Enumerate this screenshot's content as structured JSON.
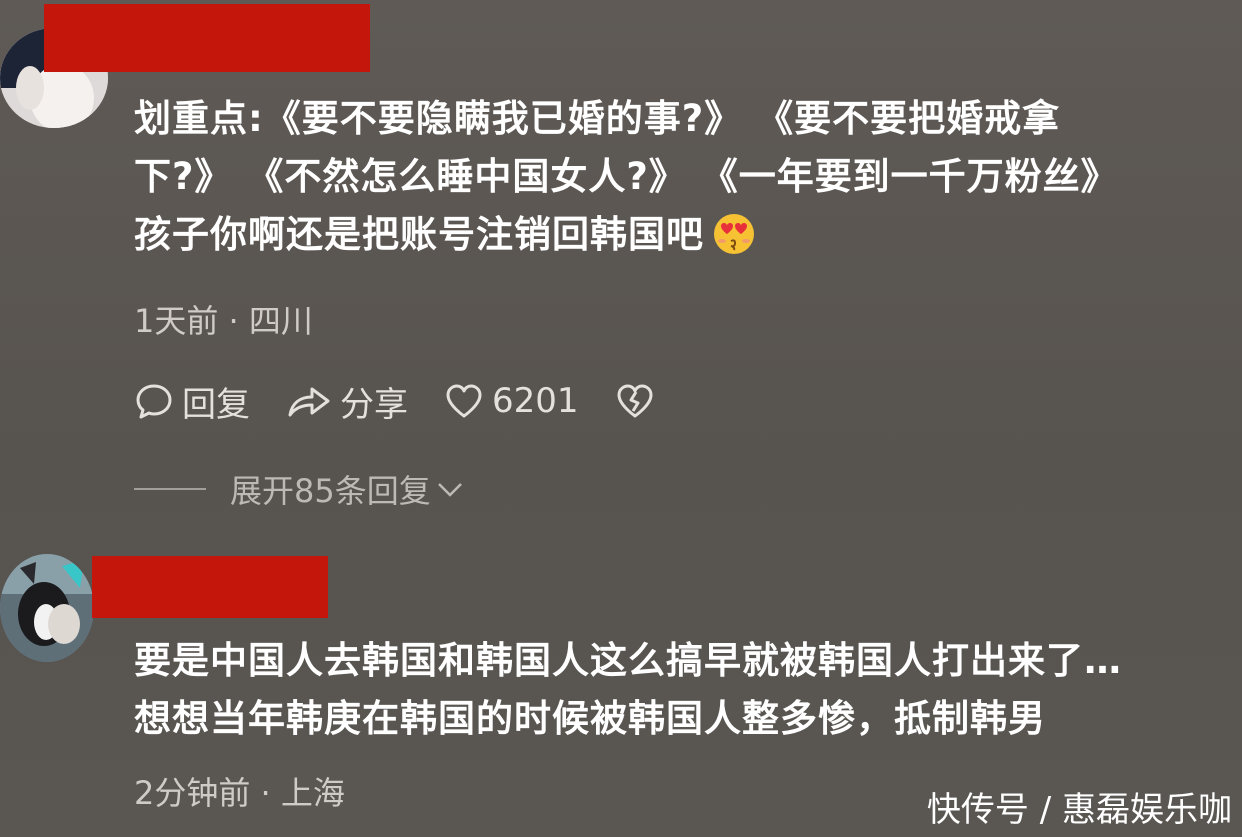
{
  "comments": [
    {
      "text_lines": [
        "划重点:《要不要隐瞒我已婚的事?》 《要不要把婚戒拿",
        "下?》 《不然怎么睡中国女人?》 《一年要到一千万粉丝》",
        "孩子你啊还是把账号注销回韩国吧"
      ],
      "emoji": "heart-eyes-kiss-emoji",
      "meta": "1天前 · 四川",
      "actions": {
        "reply_label": "回复",
        "share_label": "分享",
        "like_count": "6201"
      },
      "expand_replies_label": "展开85条回复"
    },
    {
      "text_lines": [
        "要是中国人去韩国和韩国人这么搞早就被韩国人打出来了…",
        "想想当年韩庚在韩国的时候被韩国人整多惨，抵制韩男"
      ],
      "meta": "2分钟前 · 上海"
    }
  ],
  "watermark": "快传号 / 惠磊娱乐咖",
  "colors": {
    "background": "#5b5753",
    "redaction": "#c4160a",
    "text": "#ffffff",
    "meta_text": "#cfcbc6"
  }
}
